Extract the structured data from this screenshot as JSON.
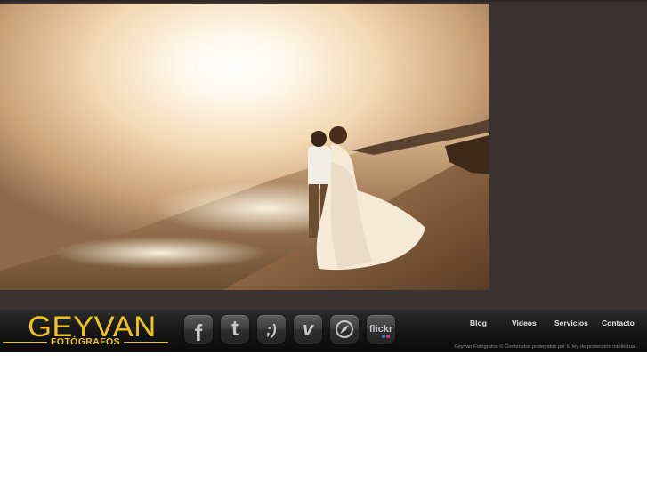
{
  "brand": {
    "name": "GEYVAN",
    "subtitle": "FOTÓGRAFOS",
    "color": "#f1c21b"
  },
  "hero": {
    "icon": "wedding-couple-beach-photo"
  },
  "social": [
    {
      "name": "facebook",
      "glyph": "f",
      "icon": "facebook-icon"
    },
    {
      "name": "twitter",
      "glyph": "t",
      "icon": "twitter-icon"
    },
    {
      "name": "tuenti",
      "glyph": ";)",
      "icon": "tuenti-icon"
    },
    {
      "name": "vimeo",
      "glyph": "v",
      "icon": "vimeo-icon"
    },
    {
      "name": "compass",
      "glyph": "",
      "icon": "compass-icon"
    },
    {
      "name": "flickr",
      "glyph": "flickr",
      "icon": "flickr-icon"
    }
  ],
  "nav": {
    "blog": "Blog",
    "videos": "Videos",
    "servicios": "Servicios",
    "contacto": "Contacto"
  },
  "footer": {
    "copyright": "Geyvan Fotógrafos © Contenidos protegidos por la ley de protección intelectual."
  },
  "colors": {
    "background": "#3a3331",
    "footer": "#151515",
    "accent": "#f1c21b"
  }
}
